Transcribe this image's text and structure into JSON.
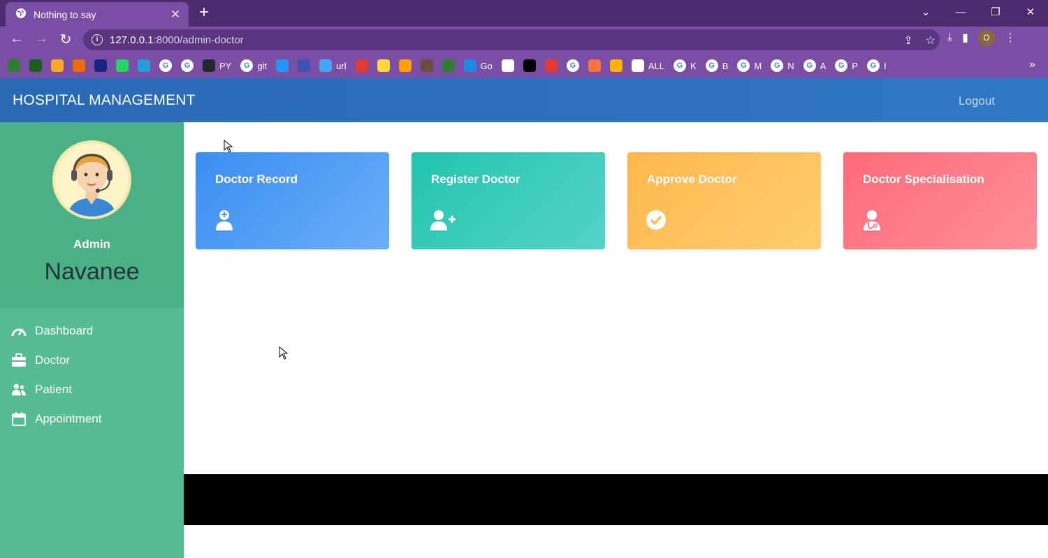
{
  "browser": {
    "tab_title": "Nothing to say",
    "url_host": "127.0.0.1",
    "url_path": ":8000/admin-doctor",
    "profile_initial": "O",
    "bookmarks": [
      {
        "icon": "bookmark-icon-green",
        "label": ""
      },
      {
        "icon": "bookmark-icon-plus",
        "label": ""
      },
      {
        "icon": "bookmark-icon-orange",
        "label": ""
      },
      {
        "icon": "bar-chart-icon",
        "label": ""
      },
      {
        "icon": "ieee-icon",
        "label": ""
      },
      {
        "icon": "whatsapp-icon",
        "label": ""
      },
      {
        "icon": "telegram-icon",
        "label": ""
      },
      {
        "icon": "google-icon",
        "label": ""
      },
      {
        "icon": "google-icon",
        "label": ""
      },
      {
        "icon": "github-icon",
        "label": "PY"
      },
      {
        "icon": "google-icon",
        "label": "git"
      },
      {
        "icon": "calendar-icon",
        "label": ""
      },
      {
        "icon": "store-icon",
        "label": ""
      },
      {
        "icon": "wifi-icon",
        "label": "url"
      },
      {
        "icon": "youtube-icon",
        "label": ""
      },
      {
        "icon": "p-icon",
        "label": ""
      },
      {
        "icon": "video-icon",
        "label": ""
      },
      {
        "icon": "brave-icon",
        "label": ""
      },
      {
        "icon": "circle-icon",
        "label": ""
      },
      {
        "icon": "go-icon",
        "label": "Go"
      },
      {
        "icon": "notion-icon",
        "label": ""
      },
      {
        "icon": "cl-icon",
        "label": ""
      },
      {
        "icon": "yandex-icon",
        "label": ""
      },
      {
        "icon": "google-icon",
        "label": ""
      },
      {
        "icon": "figma-icon",
        "label": ""
      },
      {
        "icon": "eye-icon",
        "label": ""
      },
      {
        "icon": "globe-icon",
        "label": "ALL"
      },
      {
        "icon": "google-icon",
        "label": "K"
      },
      {
        "icon": "google-icon",
        "label": "B"
      },
      {
        "icon": "google-icon",
        "label": "M"
      },
      {
        "icon": "google-icon",
        "label": "N"
      },
      {
        "icon": "google-icon",
        "label": "A"
      },
      {
        "icon": "google-icon",
        "label": "P"
      },
      {
        "icon": "google-icon",
        "label": "I"
      }
    ]
  },
  "header": {
    "brand": "HOSPITAL MANAGEMENT",
    "logout": "Logout"
  },
  "sidebar": {
    "role": "Admin",
    "name": "Navanee",
    "items": [
      {
        "label": "Dashboard",
        "icon": "speedometer-icon"
      },
      {
        "label": "Doctor",
        "icon": "briefcase-icon"
      },
      {
        "label": "Patient",
        "icon": "users-icon"
      },
      {
        "label": "Appointment",
        "icon": "calendar-icon"
      }
    ]
  },
  "cards": [
    {
      "title": "Doctor Record",
      "icon": "user-doctor-icon",
      "colors": [
        "#3b8ef2",
        "#6aaef8"
      ]
    },
    {
      "title": "Register Doctor",
      "icon": "user-plus-icon",
      "colors": [
        "#22c4b0",
        "#55d3c6"
      ]
    },
    {
      "title": "Approve Doctor",
      "icon": "check-circle-icon",
      "colors": [
        "#ffb74d",
        "#ffcd6e"
      ]
    },
    {
      "title": "Doctor Specialisation",
      "icon": "stethoscope-user-icon",
      "colors": [
        "#ff6a7a",
        "#ff8f98"
      ]
    }
  ]
}
